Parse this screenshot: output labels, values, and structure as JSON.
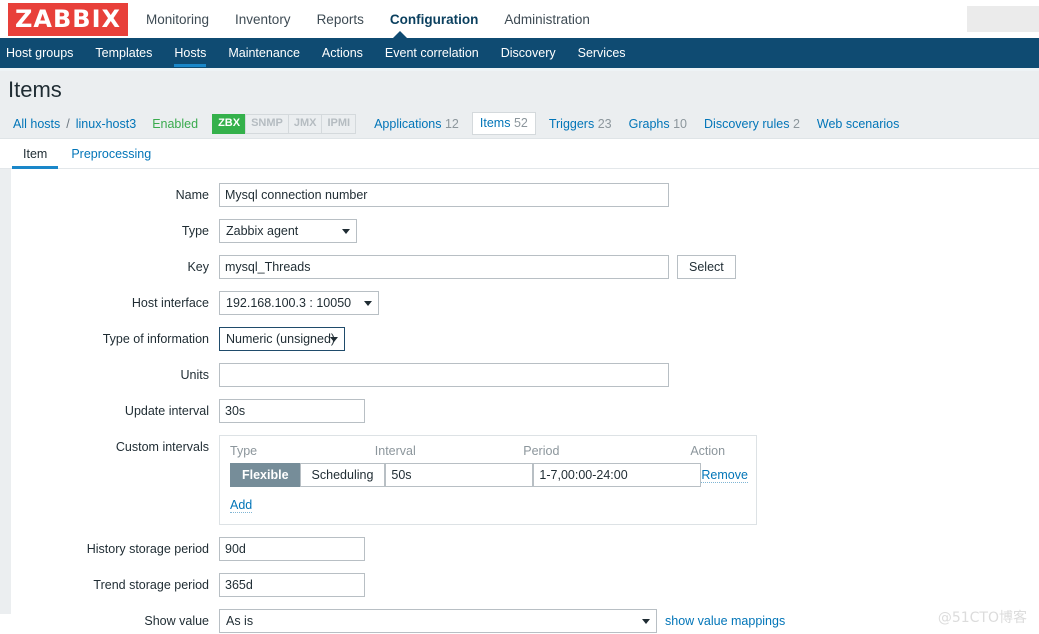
{
  "header": {
    "logo": "ZABBIX",
    "nav": [
      {
        "label": "Monitoring",
        "active": false
      },
      {
        "label": "Inventory",
        "active": false
      },
      {
        "label": "Reports",
        "active": false
      },
      {
        "label": "Configuration",
        "active": true
      },
      {
        "label": "Administration",
        "active": false
      }
    ],
    "search_value": "",
    "search_placeholder": ""
  },
  "subnav": {
    "items": [
      {
        "label": "Host groups",
        "active": false
      },
      {
        "label": "Templates",
        "active": false
      },
      {
        "label": "Hosts",
        "active": true
      },
      {
        "label": "Maintenance",
        "active": false
      },
      {
        "label": "Actions",
        "active": false
      },
      {
        "label": "Event correlation",
        "active": false
      },
      {
        "label": "Discovery",
        "active": false
      },
      {
        "label": "Services",
        "active": false
      }
    ]
  },
  "page": {
    "title": "Items"
  },
  "breadcrumb": {
    "all_hosts": "All hosts",
    "separator": "/",
    "host": "linux-host3",
    "status": "Enabled",
    "interfaces": [
      {
        "label": "ZBX",
        "enabled": true
      },
      {
        "label": "SNMP",
        "enabled": false
      },
      {
        "label": "JMX",
        "enabled": false
      },
      {
        "label": "IPMI",
        "enabled": false
      }
    ],
    "links": [
      {
        "label": "Applications",
        "count": "12",
        "active": false
      },
      {
        "label": "Items",
        "count": "52",
        "active": true
      },
      {
        "label": "Triggers",
        "count": "23",
        "active": false
      },
      {
        "label": "Graphs",
        "count": "10",
        "active": false
      },
      {
        "label": "Discovery rules",
        "count": "2",
        "active": false
      },
      {
        "label": "Web scenarios",
        "count": "",
        "active": false
      }
    ]
  },
  "tabs": [
    {
      "label": "Item",
      "active": true
    },
    {
      "label": "Preprocessing",
      "active": false
    }
  ],
  "form": {
    "name": {
      "label": "Name",
      "value": "Mysql connection number"
    },
    "type": {
      "label": "Type",
      "value": "Zabbix agent"
    },
    "key": {
      "label": "Key",
      "value": "mysql_Threads",
      "select_button": "Select"
    },
    "host_interface": {
      "label": "Host interface",
      "value": "192.168.100.3 : 10050"
    },
    "type_of_information": {
      "label": "Type of information",
      "value": "Numeric (unsigned)"
    },
    "units": {
      "label": "Units",
      "value": ""
    },
    "update_interval": {
      "label": "Update interval",
      "value": "30s"
    },
    "custom_intervals": {
      "label": "Custom intervals",
      "columns": [
        "Type",
        "Interval",
        "Period",
        "Action"
      ],
      "rows": [
        {
          "type_flexible": "Flexible",
          "type_scheduling": "Scheduling",
          "selected": "Flexible",
          "interval": "50s",
          "period": "1-7,00:00-24:00",
          "action": "Remove"
        }
      ],
      "add_label": "Add"
    },
    "history_storage_period": {
      "label": "History storage period",
      "value": "90d"
    },
    "trend_storage_period": {
      "label": "Trend storage period",
      "value": "365d"
    },
    "show_value": {
      "label": "Show value",
      "value": "As is",
      "link": "show value mappings"
    }
  },
  "watermark": "@51CTO博客",
  "colors": {
    "brand_red": "#e8403a",
    "navy": "#0f4b72",
    "accent_blue": "#1a87c9",
    "link_blue": "#0275b8",
    "green": "#34b14b",
    "toggle_on": "#768d99"
  }
}
